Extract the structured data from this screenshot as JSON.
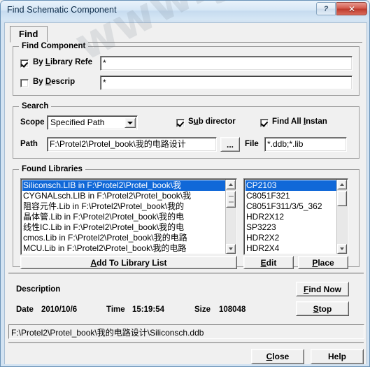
{
  "window": {
    "title": "Find Schematic Component",
    "help_button": "?",
    "close_button": "✕"
  },
  "tabs": [
    {
      "label": "Find",
      "active": true
    }
  ],
  "find_component": {
    "title": "Find Component",
    "by_library_ref": {
      "label_pre": "By ",
      "label_accel": "L",
      "label_post": "ibrary Refe",
      "checked": true,
      "value": "*"
    },
    "by_description": {
      "label_pre": "By ",
      "label_accel": "D",
      "label_post": "escrip",
      "checked": false,
      "value": "*"
    }
  },
  "search": {
    "title": "Search",
    "scope_label": "Scope",
    "scope_value": "Specified Path",
    "sub_directories": {
      "label_pre": "S",
      "label_accel": "u",
      "label_post": "b director",
      "checked": true
    },
    "find_all_instances": {
      "label_pre": "Find All ",
      "label_accel": "I",
      "label_post": "nstan",
      "checked": true
    },
    "path_label": "Path",
    "path_value": "F:\\Protel2\\Protel_book\\我的电路设计",
    "browse_button": "...",
    "file_label": "File",
    "file_value": "*.ddb;*.lib"
  },
  "found_libraries": {
    "title": "Found Libraries",
    "libraries": [
      {
        "text": "Siliconsch.LIB in F:\\Protel2\\Protel_book\\我",
        "selected": true
      },
      {
        "text": "CYGNALsch.LIB in F:\\Protel2\\Protel_book\\我",
        "selected": false
      },
      {
        "text": "阻容元件.Lib in F:\\Protel2\\Protel_book\\我的",
        "selected": false
      },
      {
        "text": "晶体管.Lib in F:\\Protel2\\Protel_book\\我的电",
        "selected": false
      },
      {
        "text": "线性IC.Lib in F:\\Protel2\\Protel_book\\我的电",
        "selected": false
      },
      {
        "text": "cmos.Lib in F:\\Protel2\\Protel_book\\我的电路",
        "selected": false
      },
      {
        "text": "MCU.Lib in F:\\Protel2\\Protel_book\\我的电路",
        "selected": false
      }
    ],
    "components": [
      {
        "text": "CP2103",
        "selected": true
      },
      {
        "text": "C8051F321",
        "selected": false
      },
      {
        "text": "C8051F311/3/5_362",
        "selected": false
      },
      {
        "text": "HDR2X12",
        "selected": false
      },
      {
        "text": "SP3223",
        "selected": false
      },
      {
        "text": "HDR2X2",
        "selected": false
      },
      {
        "text": "HDR2X4",
        "selected": false
      }
    ],
    "add_to_library_list": {
      "label_pre": "",
      "label_accel": "A",
      "label_post": "dd To Library List"
    },
    "edit_button": {
      "label_pre": "",
      "label_accel": "E",
      "label_post": "dit"
    },
    "place_button": {
      "label_pre": "",
      "label_accel": "P",
      "label_post": "lace"
    }
  },
  "details": {
    "description_label": "Description",
    "date_label": "Date",
    "date_value": "2010/10/6",
    "time_label": "Time",
    "time_value": "15:19:54",
    "size_label": "Size",
    "size_value": "108048",
    "find_now_button": {
      "label_pre": "",
      "label_accel": "F",
      "label_post": "ind Now"
    },
    "stop_button": {
      "label_pre": "",
      "label_accel": "S",
      "label_post": "top"
    }
  },
  "status_bar": {
    "text": "F:\\Protel2\\Protel_book\\我的电路设计\\Siliconsch.ddb"
  },
  "footer": {
    "close_button": {
      "label_pre": "",
      "label_accel": "C",
      "label_post": "lose"
    },
    "help_button": {
      "label_pre": "",
      "label_accel": "",
      "label_post": "Help"
    }
  },
  "watermark": {
    "text": "www.greattong.com"
  },
  "colors": {
    "selection": "#1068d8",
    "window_bg": "#f0f0f0",
    "title_text": "#0b2a47",
    "close_red": "#bd3a2c"
  }
}
